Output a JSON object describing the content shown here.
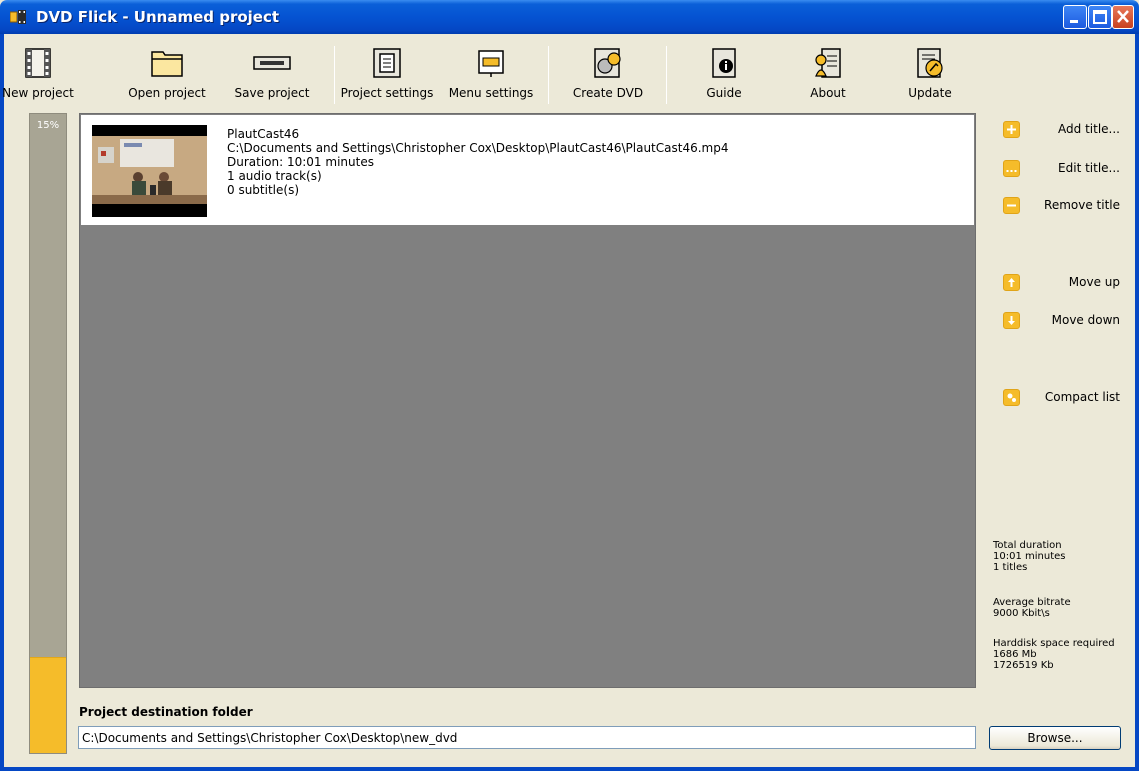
{
  "window": {
    "title": "DVD Flick - Unnamed project"
  },
  "toolbar": {
    "new_project": "New project",
    "open_project": "Open project",
    "save_project": "Save project",
    "project_settings": "Project settings",
    "menu_settings": "Menu settings",
    "create_dvd": "Create DVD",
    "guide": "Guide",
    "about": "About",
    "update": "Update"
  },
  "progress": {
    "label": "15%",
    "fraction": 0.15
  },
  "titles": [
    {
      "name": "PlautCast46",
      "path": "C:\\Documents and Settings\\Christopher Cox\\Desktop\\PlautCast46\\PlautCast46.mp4",
      "duration": "Duration: 10:01 minutes",
      "audio": "1 audio track(s)",
      "subtitles": "0 subtitle(s)"
    }
  ],
  "side": {
    "add_title": "Add title...",
    "edit_title": "Edit title...",
    "remove_title": "Remove title",
    "move_up": "Move up",
    "move_down": "Move down",
    "compact_list": "Compact list"
  },
  "stats": {
    "total_duration_label": "Total duration",
    "total_duration_value": "10:01 minutes",
    "titles_count": "1 titles",
    "avg_bitrate_label": "Average bitrate",
    "avg_bitrate_value": "9000 Kbit\\s",
    "harddisk_label": "Harddisk space required",
    "harddisk_mb": "1686 Mb",
    "harddisk_kb": "1726519 Kb"
  },
  "destination": {
    "label": "Project destination folder",
    "path": "C:\\Documents and Settings\\Christopher Cox\\Desktop\\new_dvd",
    "browse_label": "Browse..."
  }
}
